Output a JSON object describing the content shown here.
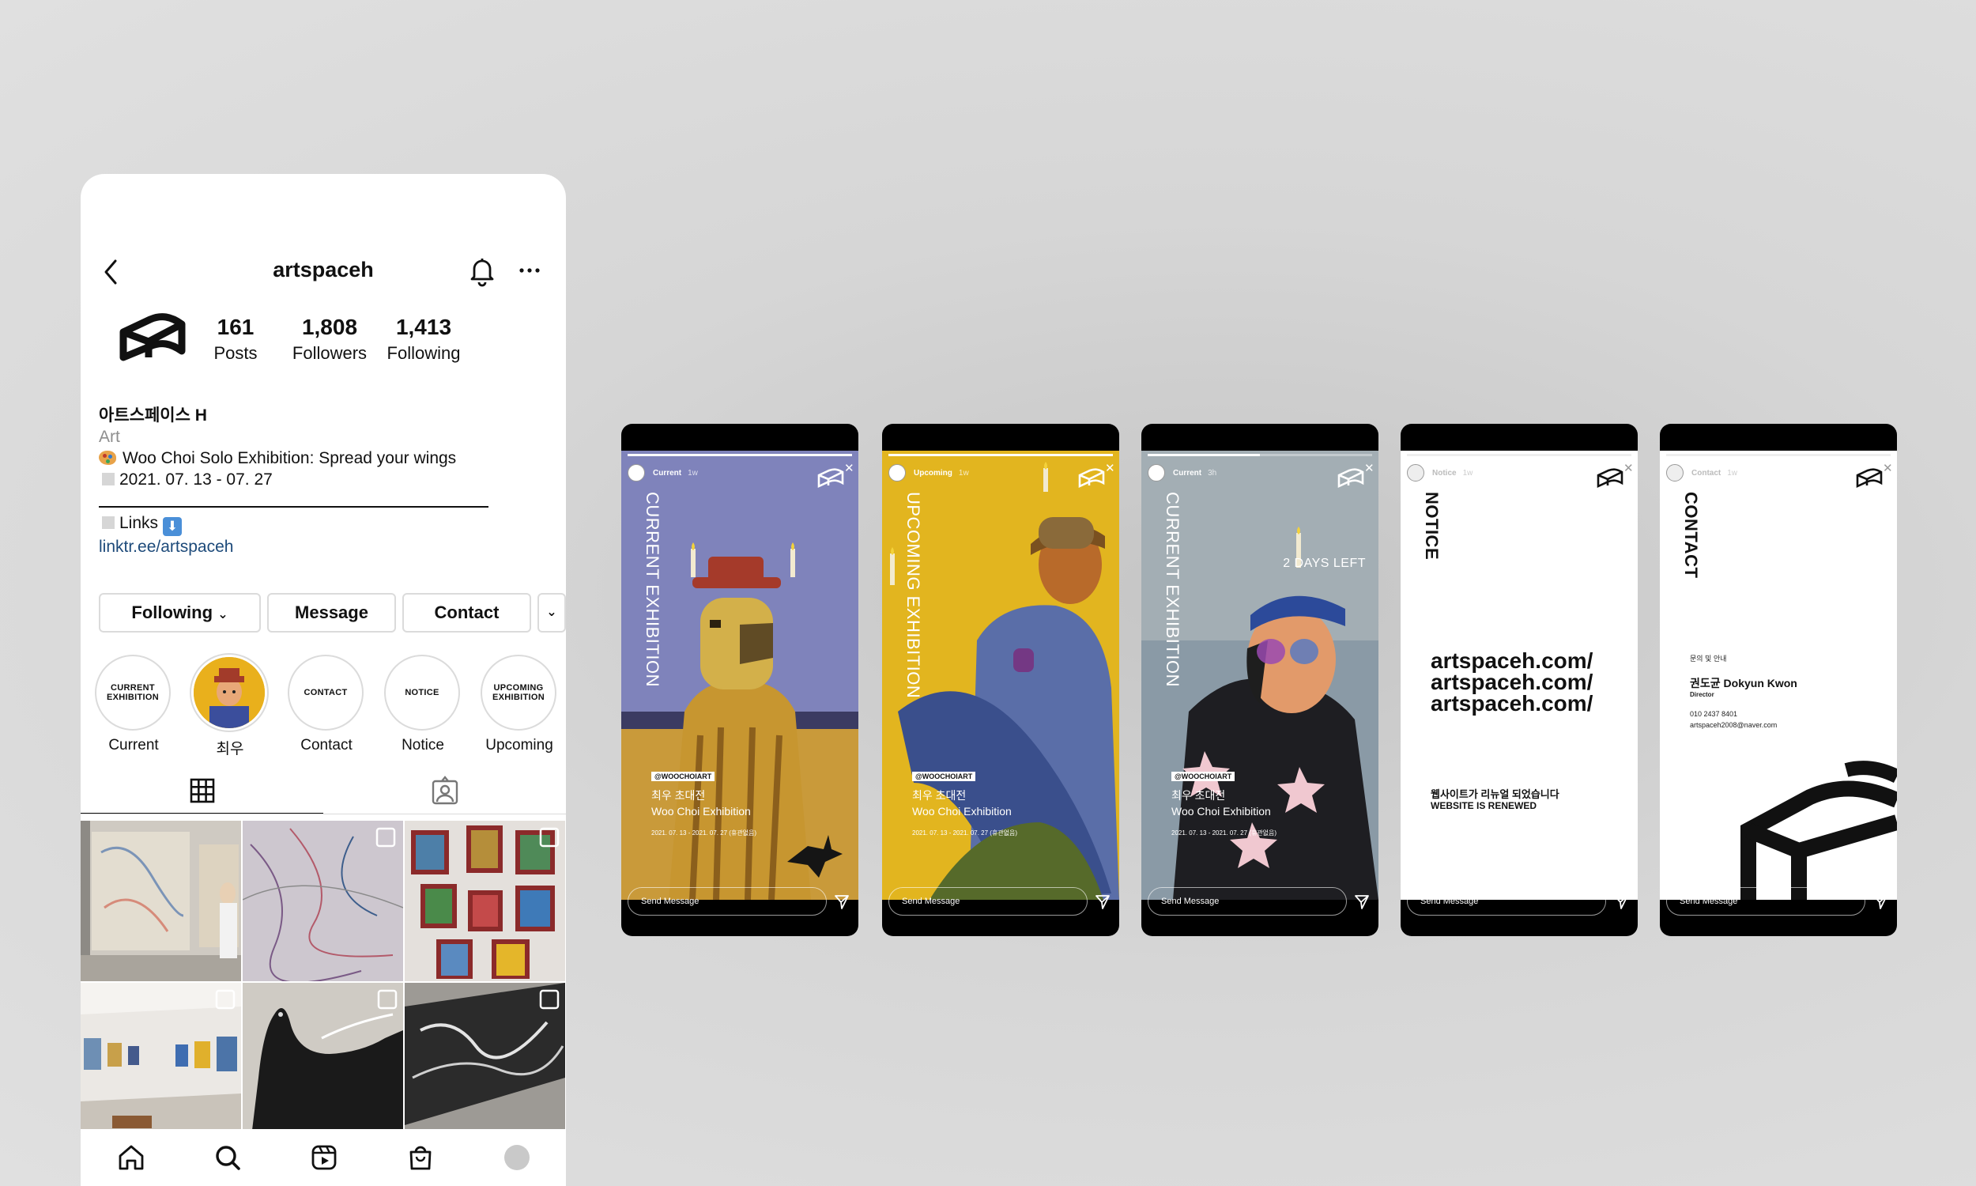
{
  "profile": {
    "username": "artspaceh",
    "stats": [
      {
        "num": "161",
        "label": "Posts"
      },
      {
        "num": "1,808",
        "label": "Followers"
      },
      {
        "num": "1,413",
        "label": "Following"
      }
    ],
    "bio": {
      "name": "아트스페이스 H",
      "category": "Art",
      "line1": "Woo Choi Solo Exhibition: Spread your wings",
      "line2": "2021. 07. 13 - 07. 27",
      "links_label": "Links",
      "link_url": "linktr.ee/artspaceh"
    },
    "buttons": {
      "following": "Following",
      "following_chevron": "⌄",
      "message": "Message",
      "contact": "Contact",
      "more_chevron": "⌄"
    },
    "highlights": [
      {
        "inner": "CURRENT EXHIBITION",
        "caption": "Current"
      },
      {
        "inner": "",
        "caption": "최우"
      },
      {
        "inner": "CONTACT",
        "caption": "Contact"
      },
      {
        "inner": "NOTICE",
        "caption": "Notice"
      },
      {
        "inner": "UPCOMING EXHIBITION",
        "caption": "Upcoming"
      }
    ]
  },
  "stories": [
    {
      "header_label": "Current",
      "header_time": "1w",
      "vertical_title": "CURRENT EXHIBITION",
      "tag": "@WOOCHOIART",
      "title_ko": "최우 초대전",
      "title_en": "Woo Choi Exhibition",
      "date": "2021. 07. 13 - 2021. 07. 27 (휴관없음)",
      "send": "Send Message",
      "progress": 1.0
    },
    {
      "header_label": "Upcoming",
      "header_time": "1w",
      "vertical_title": "UPCOMING EXHIBITION",
      "tag": "@WOOCHOIART",
      "title_ko": "최우 초대전",
      "title_en": "Woo Choi Exhibition",
      "date": "2021. 07. 13 - 2021. 07. 27 (휴관없음)",
      "send": "Send Message",
      "progress": 1.0
    },
    {
      "header_label": "Current",
      "header_time": "3h",
      "vertical_title": "CURRENT EXHIBITION",
      "badge": "2 DAYS LEFT",
      "tag": "@WOOCHOIART",
      "title_ko": "최우 초대전",
      "title_en": "Woo Choi Exhibition",
      "date": "2021. 07. 13 - 2021. 07. 27 (휴관없음)",
      "send": "Send Message",
      "progress": 0.5
    },
    {
      "header_label": "Notice",
      "header_time": "1w",
      "vertical_title": "NOTICE",
      "urls": [
        "artspaceh.com/",
        "artspaceh.com/",
        "artspaceh.com/"
      ],
      "msg_ko": "웹사이트가 리뉴얼 되었습니다",
      "msg_en": "WEBSITE IS RENEWED",
      "send": "Send Message",
      "progress": 1.0
    },
    {
      "header_label": "Contact",
      "header_time": "1w",
      "vertical_title": "CONTACT",
      "label_ko": "문의 및 안내",
      "name": "권도균 Dokyun Kwon",
      "role": "Director",
      "phone": "010 2437 8401",
      "email": "artspaceh2008@naver.com",
      "send": "Send Message",
      "progress": 1.0
    }
  ],
  "colors": {
    "link": "#1d4a7a",
    "story_yellow": "#e2b51f",
    "story_blue": "#7f83bb"
  }
}
